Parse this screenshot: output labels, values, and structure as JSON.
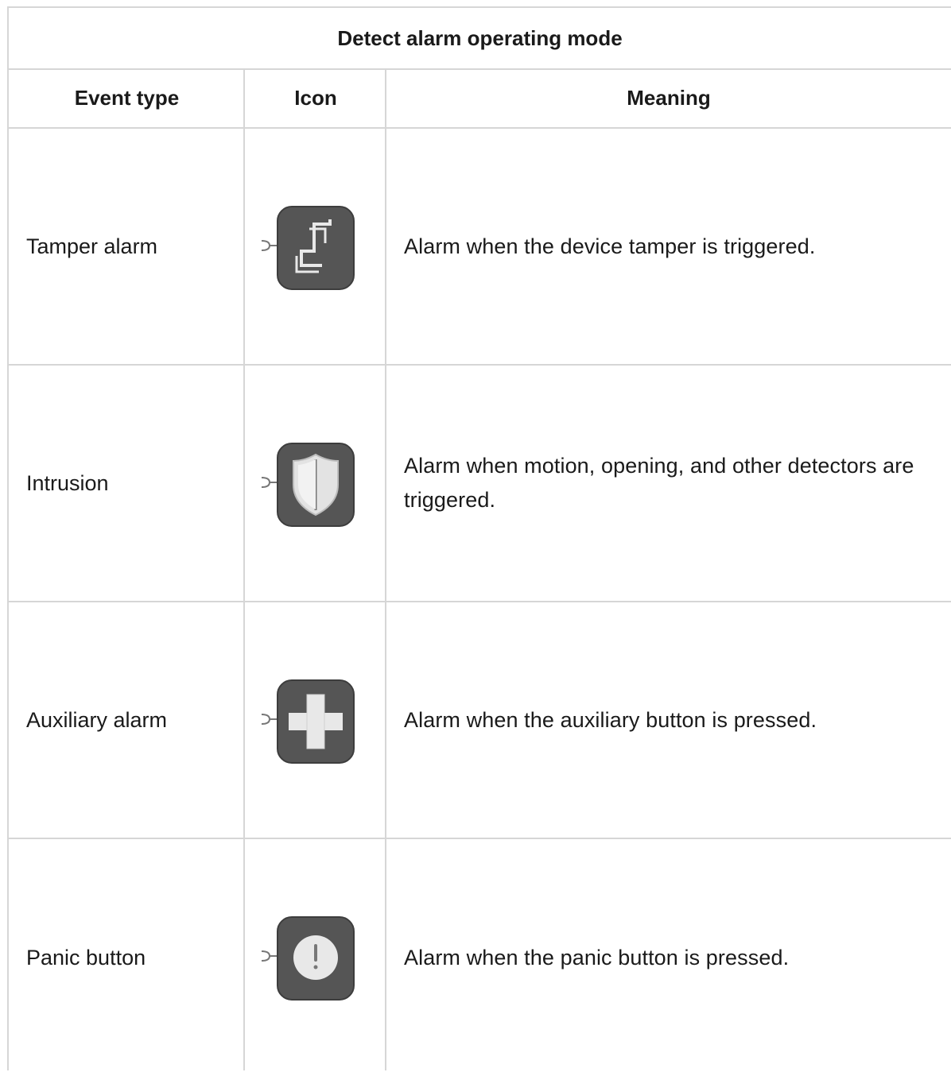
{
  "table": {
    "title": "Detect alarm operating mode",
    "headers": {
      "event_type": "Event type",
      "icon": "Icon",
      "meaning": "Meaning"
    },
    "rows": [
      {
        "event_type": "Tamper alarm",
        "icon": "tamper-icon",
        "meaning": "Alarm when the device tamper is triggered."
      },
      {
        "event_type": "Intrusion",
        "icon": "shield-icon",
        "meaning": "Alarm when motion, opening, and other detectors are triggered."
      },
      {
        "event_type": "Auxiliary alarm",
        "icon": "plus-icon",
        "meaning": "Alarm when the auxiliary button is pressed."
      },
      {
        "event_type": "Panic button",
        "icon": "exclamation-icon",
        "meaning": "Alarm when the panic button is pressed."
      }
    ]
  },
  "colors": {
    "border": "#d6d6d6",
    "icon_bg": "#555555",
    "icon_fg": "#e8e8e8"
  }
}
